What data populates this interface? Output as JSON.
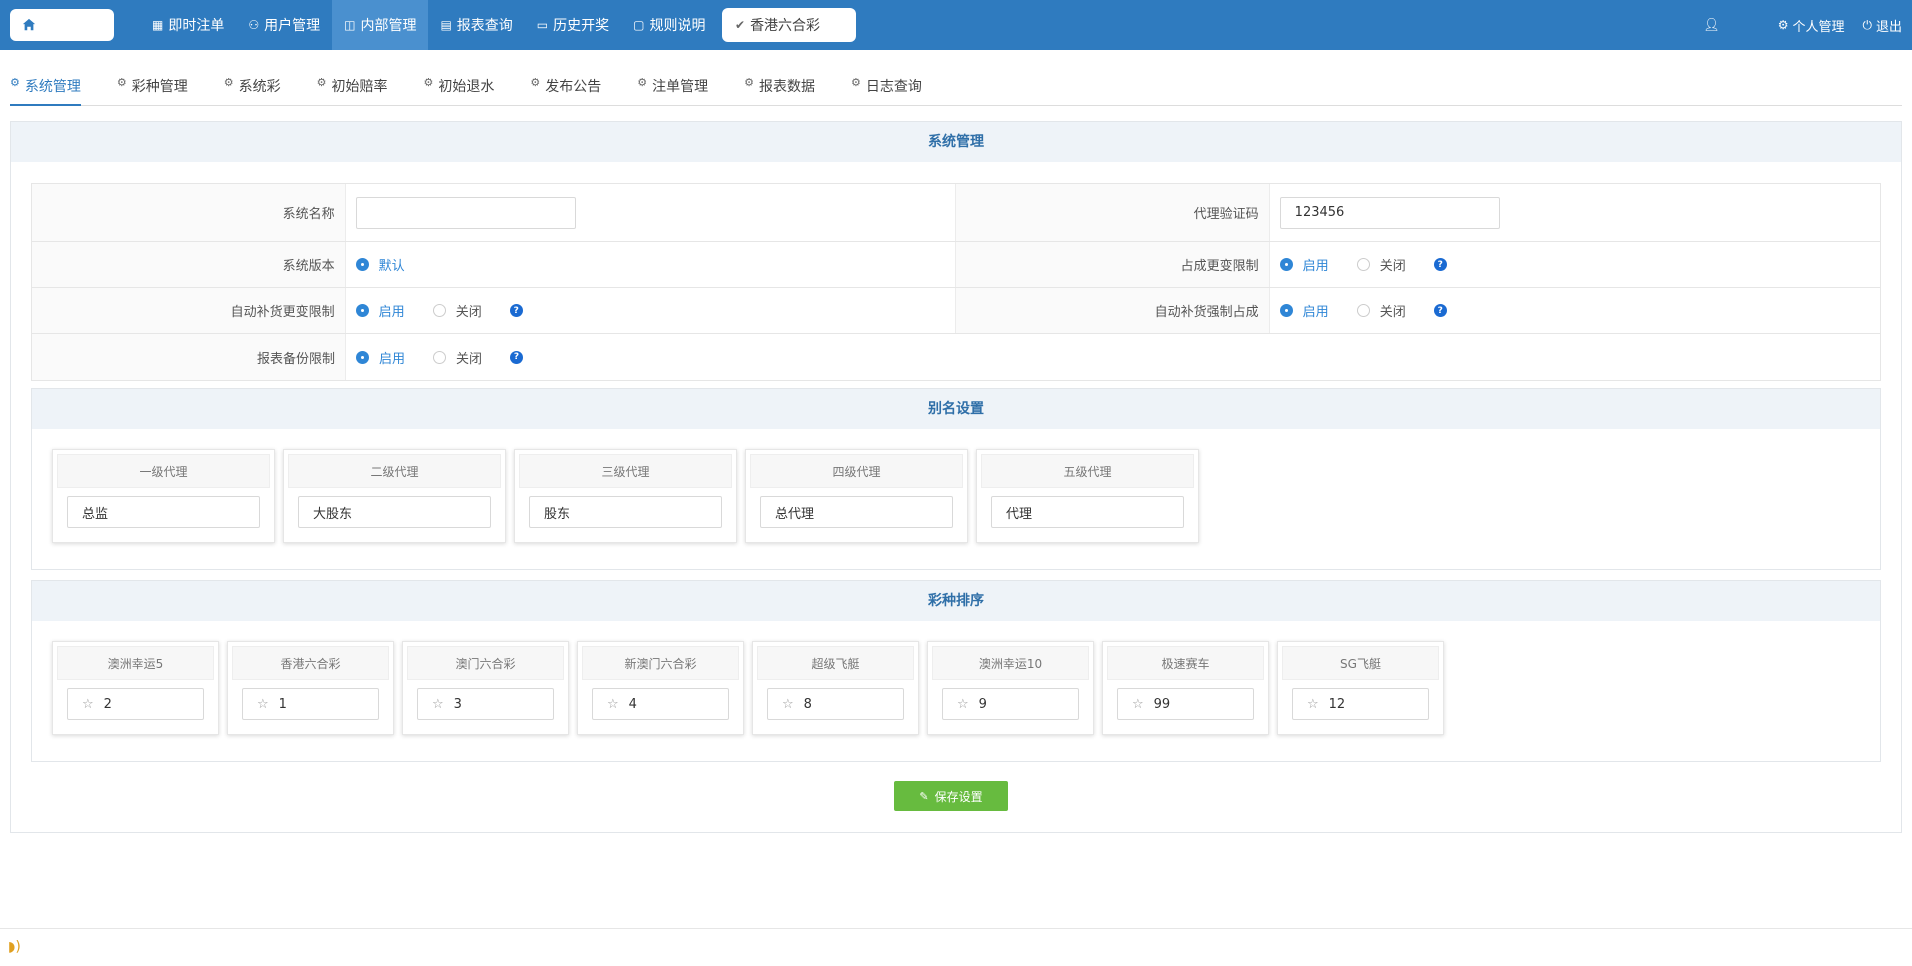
{
  "nav": {
    "items": [
      {
        "label": "即时注单",
        "icon": "grid-icon"
      },
      {
        "label": "用户管理",
        "icon": "user-icon"
      },
      {
        "label": "内部管理",
        "icon": "book-icon",
        "active": true
      },
      {
        "label": "报表查询",
        "icon": "report-icon"
      },
      {
        "label": "历史开奖",
        "icon": "monitor-icon"
      },
      {
        "label": "规则说明",
        "icon": "chat-icon"
      }
    ],
    "game": "香港六合彩",
    "right": {
      "profile": "个人管理",
      "logout": "退出"
    }
  },
  "subtabs": [
    {
      "label": "系统管理",
      "active": true
    },
    {
      "label": "彩种管理"
    },
    {
      "label": "系统彩"
    },
    {
      "label": "初始赔率"
    },
    {
      "label": "初始退水"
    },
    {
      "label": "发布公告"
    },
    {
      "label": "注单管理"
    },
    {
      "label": "报表数据"
    },
    {
      "label": "日志查询"
    }
  ],
  "system": {
    "title": "系统管理",
    "name_label": "系统名称",
    "name_value": "",
    "agent_code_label": "代理验证码",
    "agent_code_value": "123456",
    "version_label": "系统版本",
    "version_option": "默认",
    "share_limit_label": "占成更变限制",
    "auto_limit_label": "自动补货更变限制",
    "auto_force_label": "自动补货强制占成",
    "backup_limit_label": "报表备份限制",
    "on": "启用",
    "off": "关闭",
    "help": "?"
  },
  "alias": {
    "title": "别名设置",
    "levels": [
      {
        "label": "一级代理",
        "value": "总监"
      },
      {
        "label": "二级代理",
        "value": "大股东"
      },
      {
        "label": "三级代理",
        "value": "股东"
      },
      {
        "label": "四级代理",
        "value": "总代理"
      },
      {
        "label": "五级代理",
        "value": "代理"
      }
    ]
  },
  "sort": {
    "title": "彩种排序",
    "items": [
      {
        "label": "澳洲幸运5",
        "value": "2"
      },
      {
        "label": "香港六合彩",
        "value": "1"
      },
      {
        "label": "澳门六合彩",
        "value": "3"
      },
      {
        "label": "新澳门六合彩",
        "value": "4"
      },
      {
        "label": "超级飞艇",
        "value": "8"
      },
      {
        "label": "澳洲幸运10",
        "value": "9"
      },
      {
        "label": "极速赛车",
        "value": "99"
      },
      {
        "label": "SG飞艇",
        "value": "12"
      }
    ]
  },
  "save_label": "保存设置",
  "colors": {
    "nav_bg": "#2f7bbf",
    "accent": "#2f86d6",
    "save": "#67bb3f"
  }
}
